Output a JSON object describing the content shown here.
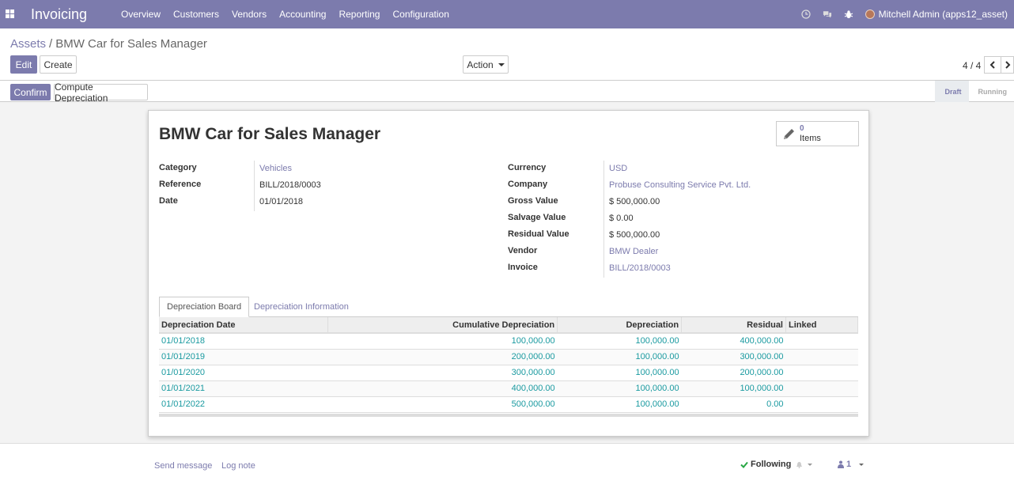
{
  "navbar": {
    "app_name": "Invoicing",
    "menu": [
      "Overview",
      "Customers",
      "Vendors",
      "Accounting",
      "Reporting",
      "Configuration"
    ],
    "user": "Mitchell Admin (apps12_asset)",
    "icons": [
      "clock-icon",
      "chat-icon",
      "bug-icon"
    ]
  },
  "breadcrumb": {
    "parent": "Assets",
    "separator": "/",
    "current": "BMW Car for Sales Manager"
  },
  "buttons": {
    "edit": "Edit",
    "create": "Create",
    "action": "Action",
    "confirm": "Confirm",
    "compute_depreciation": "Compute Depreciation"
  },
  "pager": {
    "value": "4 / 4"
  },
  "status": {
    "steps": [
      "Draft",
      "Running"
    ],
    "active": "Draft"
  },
  "record": {
    "title": "BMW Car for Sales Manager",
    "smart_button": {
      "value": "0",
      "label": "Items"
    },
    "left_fields": [
      {
        "label": "Category",
        "value": "Vehicles",
        "link": true
      },
      {
        "label": "Reference",
        "value": "BILL/2018/0003",
        "link": false
      },
      {
        "label": "Date",
        "value": "01/01/2018",
        "link": false
      }
    ],
    "right_fields": [
      {
        "label": "Currency",
        "value": "USD",
        "link": true
      },
      {
        "label": "Company",
        "value": "Probuse Consulting Service Pvt. Ltd.",
        "link": true
      },
      {
        "label": "Gross Value",
        "value": "$ 500,000.00",
        "link": false
      },
      {
        "label": "Salvage Value",
        "value": "$ 0.00",
        "link": false
      },
      {
        "label": "Residual Value",
        "value": "$ 500,000.00",
        "link": false
      },
      {
        "label": "Vendor",
        "value": "BMW Dealer",
        "link": true
      },
      {
        "label": "Invoice",
        "value": "BILL/2018/0003",
        "link": true
      }
    ]
  },
  "tabs": [
    "Depreciation Board",
    "Depreciation Information"
  ],
  "table": {
    "headers": [
      "Depreciation Date",
      "Cumulative Depreciation",
      "Depreciation",
      "Residual",
      "Linked"
    ],
    "rows": [
      [
        "01/01/2018",
        "100,000.00",
        "100,000.00",
        "400,000.00",
        ""
      ],
      [
        "01/01/2019",
        "200,000.00",
        "100,000.00",
        "300,000.00",
        ""
      ],
      [
        "01/01/2020",
        "300,000.00",
        "100,000.00",
        "200,000.00",
        ""
      ],
      [
        "01/01/2021",
        "400,000.00",
        "100,000.00",
        "100,000.00",
        ""
      ],
      [
        "01/01/2022",
        "500,000.00",
        "100,000.00",
        "0.00",
        ""
      ]
    ]
  },
  "chatter": {
    "send_message": "Send message",
    "log_note": "Log note",
    "following": "Following",
    "followers_count": "1"
  },
  "colors": {
    "brand": "#7c7bad",
    "link_teal": "#1a9aa0"
  }
}
